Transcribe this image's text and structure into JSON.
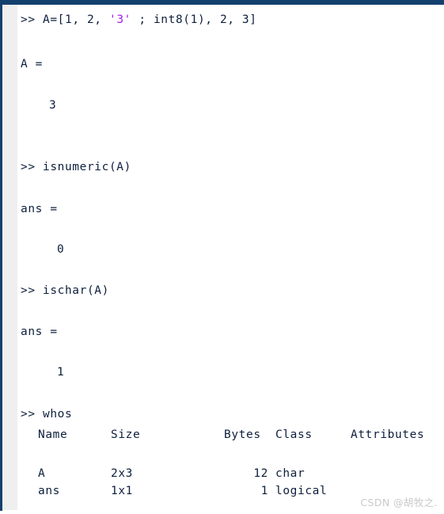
{
  "window": {
    "app_name": "MATLAB Command Window",
    "accent_color": "#14406e",
    "gutter_color": "#efefef",
    "text_color": "#0d1f3c",
    "string_literal_color": "#a020f0",
    "watermark_color": "#c9c9c9"
  },
  "console": {
    "prompt": ">>",
    "entries": [
      {
        "prompt": ">>",
        "command_pre": " A=[1, 2, ",
        "command_string": "'3'",
        "command_post": " ; int8(1), 2, 3]"
      },
      {
        "result_label": "A =",
        "result_value": "3"
      },
      {
        "prompt": ">>",
        "command": " isnumeric(A)"
      },
      {
        "result_label": "ans =",
        "result_value": "0"
      },
      {
        "prompt": ">>",
        "command": " ischar(A)"
      },
      {
        "result_label": "ans =",
        "result_value": "1"
      },
      {
        "prompt": ">>",
        "command": " whos"
      }
    ],
    "line1": {
      "prompt": ">>",
      "pre": " A=[1, 2, ",
      "string": "'3'",
      "post": " ; int8(1), 2, 3]"
    },
    "line_A_label": "A =",
    "line_A_value": "3",
    "line_isnumeric": ">> isnumeric(A)",
    "line_ans1_label": "ans =",
    "line_ans1_value": "0",
    "line_ischar": ">> ischar(A)",
    "line_ans2_label": "ans =",
    "line_ans2_value": "1",
    "line_whos": ">> whos"
  },
  "whos_table": {
    "headers": {
      "name": "Name",
      "size": "Size",
      "bytes": "Bytes",
      "class": "Class",
      "attributes": "Attributes"
    },
    "rows": [
      {
        "name": "A",
        "size": "2x3",
        "bytes": "12",
        "class": "char",
        "attributes": ""
      },
      {
        "name": "ans",
        "size": "1x1",
        "bytes": "1",
        "class": "logical",
        "attributes": ""
      }
    ],
    "row0": {
      "name": "A",
      "size": "2x3",
      "bytes": "12",
      "class": "char"
    },
    "row1": {
      "name": "ans",
      "size": "1x1",
      "bytes": "1",
      "class": "logical"
    }
  },
  "watermark": {
    "text": "CSDN @胡牧之."
  }
}
